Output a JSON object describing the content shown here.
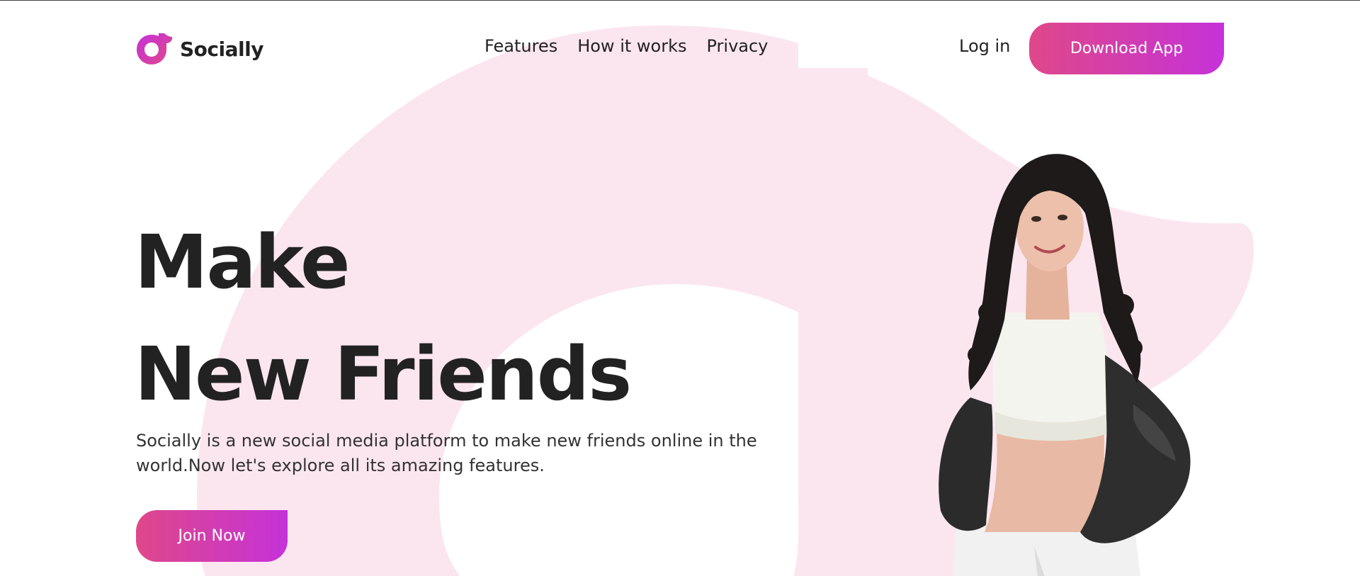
{
  "brand": {
    "name": "Socially",
    "accent_start": "#df4889",
    "accent_end": "#c532d9",
    "background_tint": "#fbe6f0",
    "logo_icon": "music-note-logo-icon"
  },
  "nav": {
    "items": [
      {
        "label": "Features"
      },
      {
        "label": "How it works"
      },
      {
        "label": "Privacy"
      }
    ],
    "login_label": "Log in",
    "download_label": "Download App"
  },
  "hero": {
    "title_line1": "Make",
    "title_line2": "New Friends",
    "description": "Socially is a new social media platform to make new friends online in the world.Now let's explore all its amazing features.",
    "cta_label": "Join Now",
    "photo_icon": "hero-model-photo"
  }
}
